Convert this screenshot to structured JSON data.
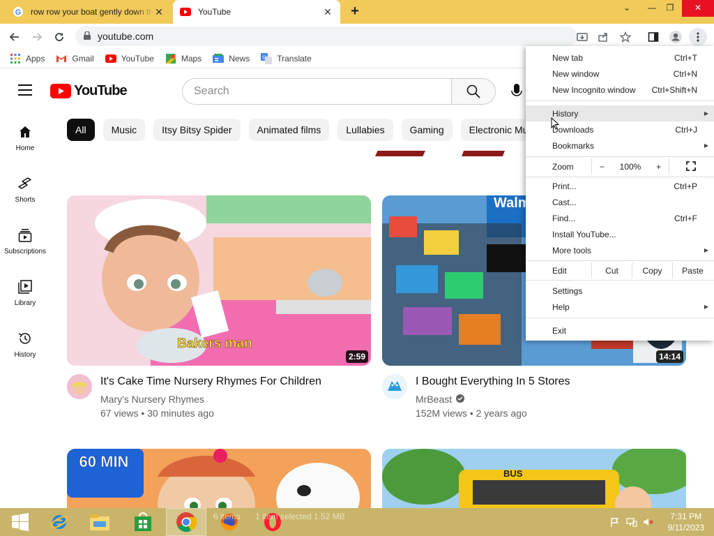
{
  "browser": {
    "tabs": [
      {
        "title": "row row your boat gently down the stream",
        "icon": "google-icon"
      },
      {
        "title": "YouTube",
        "icon": "youtube-icon"
      }
    ],
    "url": "youtube.com"
  },
  "bookmarks": [
    {
      "label": "Apps",
      "icon": "apps-grid-icon"
    },
    {
      "label": "Gmail",
      "icon": "gmail-icon"
    },
    {
      "label": "YouTube",
      "icon": "youtube-icon"
    },
    {
      "label": "Maps",
      "icon": "maps-icon"
    },
    {
      "label": "News",
      "icon": "news-icon"
    },
    {
      "label": "Translate",
      "icon": "translate-icon"
    }
  ],
  "youtube": {
    "logo_text": "YouTube",
    "search_placeholder": "Search",
    "chips": [
      "All",
      "Music",
      "Itsy Bitsy Spider",
      "Animated films",
      "Lullabies",
      "Gaming",
      "Electronic Music"
    ],
    "nav": [
      {
        "label": "Home",
        "icon": "home-icon"
      },
      {
        "label": "Shorts",
        "icon": "shorts-icon"
      },
      {
        "label": "Subscriptions",
        "icon": "subscriptions-icon"
      },
      {
        "label": "Library",
        "icon": "library-icon"
      },
      {
        "label": "History",
        "icon": "history-icon"
      }
    ],
    "videos": [
      {
        "title": "It's Cake Time Nursery Rhymes For Children",
        "channel": "Mary's Nursery Rhymes",
        "meta": "67 views • 30 minutes ago",
        "duration": "2:59",
        "thumb_caption": "Bakers man"
      },
      {
        "title": "I Bought Everything In 5 Stores",
        "channel": "MrBeast",
        "meta": "152M views • 2 years ago",
        "duration": "14:14",
        "thumb_caption": "Walm"
      },
      {
        "thumb_caption": "60 MIN"
      },
      {
        "thumb_caption": "BUS"
      }
    ]
  },
  "chrome_menu": {
    "items": [
      {
        "label": "New tab",
        "shortcut": "Ctrl+T"
      },
      {
        "label": "New window",
        "shortcut": "Ctrl+N"
      },
      {
        "label": "New Incognito window",
        "shortcut": "Ctrl+Shift+N"
      },
      {
        "label": "History",
        "shortcut": ""
      },
      {
        "label": "Downloads",
        "shortcut": "Ctrl+J"
      },
      {
        "label": "Bookmarks",
        "shortcut": ""
      },
      {
        "label": "Print...",
        "shortcut": "Ctrl+P"
      },
      {
        "label": "Cast...",
        "shortcut": ""
      },
      {
        "label": "Find...",
        "shortcut": "Ctrl+F"
      },
      {
        "label": "Install YouTube...",
        "shortcut": ""
      },
      {
        "label": "More tools",
        "shortcut": ""
      },
      {
        "label": "Settings",
        "shortcut": ""
      },
      {
        "label": "Help",
        "shortcut": ""
      },
      {
        "label": "Exit",
        "shortcut": ""
      }
    ],
    "zoom": {
      "label": "Zoom",
      "minus": "−",
      "value": "100%",
      "plus": "+"
    },
    "edit": {
      "label": "Edit",
      "cut": "Cut",
      "copy": "Copy",
      "paste": "Paste"
    }
  },
  "taskbar": {
    "status_items": "6 items",
    "status_selected": "1 item selected  1.52 MB",
    "time": "7:31 PM",
    "date": "9/11/2023"
  },
  "colors": {
    "youtube_red": "#ff0000",
    "tabstrip": "#f1ca59",
    "taskbar": "#c8b46a"
  }
}
